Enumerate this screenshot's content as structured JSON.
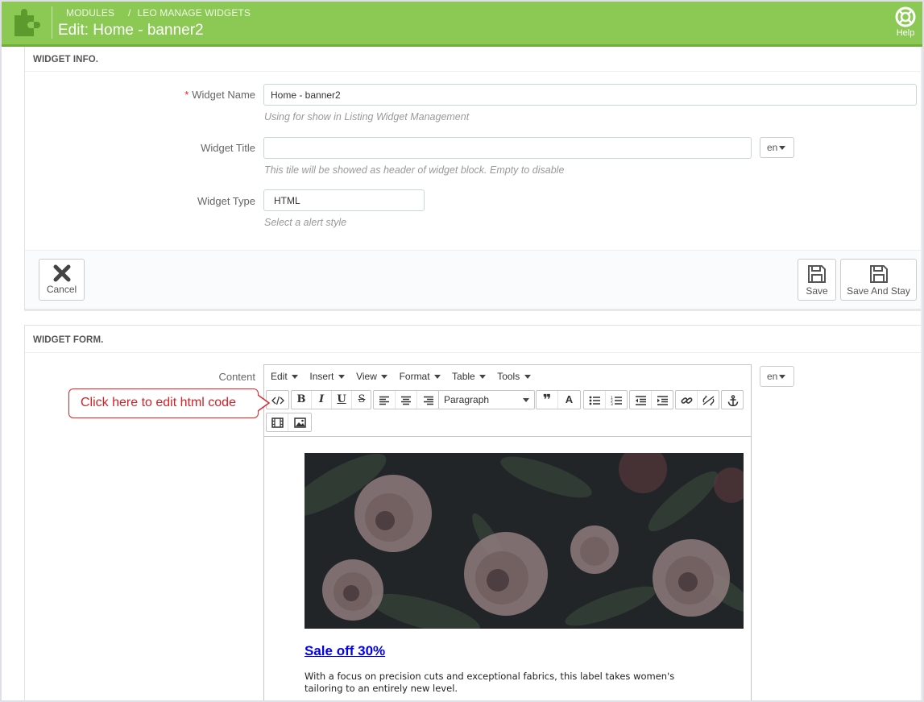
{
  "header": {
    "breadcrumb": [
      "MODULES",
      "LEO MANAGE WIDGETS"
    ],
    "title": "Edit: Home - banner2",
    "help_label": "Help"
  },
  "widget_info": {
    "heading": "WIDGET INFO.",
    "name_label": "Widget Name",
    "name_value": "Home - banner2",
    "name_hint": "Using for show in Listing Widget Management",
    "title_label": "Widget Title",
    "title_value": "",
    "title_hint": "This tile will be showed as header of widget block. Empty to disable",
    "lang": "en",
    "type_label": "Widget Type",
    "type_value": "HTML",
    "type_hint": "Select a alert style"
  },
  "actions": {
    "cancel": "Cancel",
    "save": "Save",
    "save_stay": "Save And Stay"
  },
  "widget_form": {
    "heading": "WIDGET FORM.",
    "content_label": "Content",
    "lang": "en",
    "menu": [
      "Edit",
      "Insert",
      "View",
      "Format",
      "Table",
      "Tools"
    ],
    "format_select": "Paragraph",
    "banner_heading": "Sale off 30%",
    "banner_text": "With a focus on precision cuts and exceptional fabrics, this label takes women's tailoring to an entirely new level."
  },
  "annotation": {
    "callout": "Click here to edit html code"
  },
  "colors": {
    "header_green": "#8bc954",
    "callout_red": "#e0252b",
    "link_blue": "#0000ee"
  }
}
